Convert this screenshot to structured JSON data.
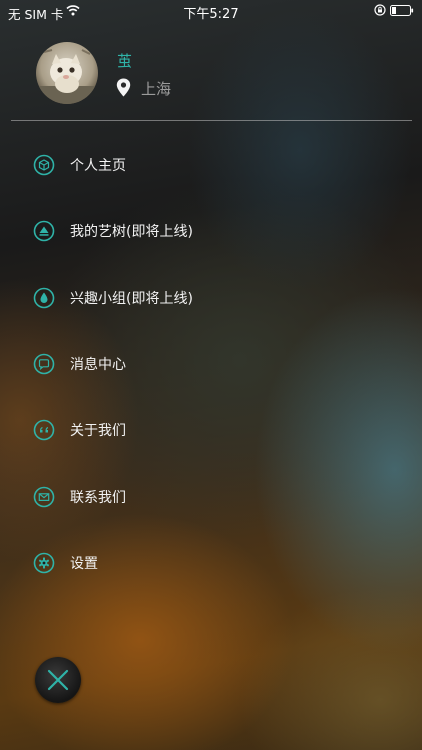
{
  "status_bar": {
    "carrier": "无 SIM 卡",
    "time": "下午5:27"
  },
  "profile": {
    "username": "茧",
    "location": "上海"
  },
  "menu": {
    "items": [
      {
        "label": "个人主页",
        "icon": "cube-icon"
      },
      {
        "label": "我的艺树(即将上线)",
        "icon": "triangle-icon"
      },
      {
        "label": "兴趣小组(即将上线)",
        "icon": "drop-icon"
      },
      {
        "label": "消息中心",
        "icon": "chat-icon"
      },
      {
        "label": "关于我们",
        "icon": "quote-icon"
      },
      {
        "label": "联系我们",
        "icon": "mail-icon"
      },
      {
        "label": "设置",
        "icon": "gear-icon"
      }
    ]
  },
  "colors": {
    "accent": "#2fb3a8",
    "text": "#f2f2f2",
    "muted": "#9b9b9b"
  }
}
